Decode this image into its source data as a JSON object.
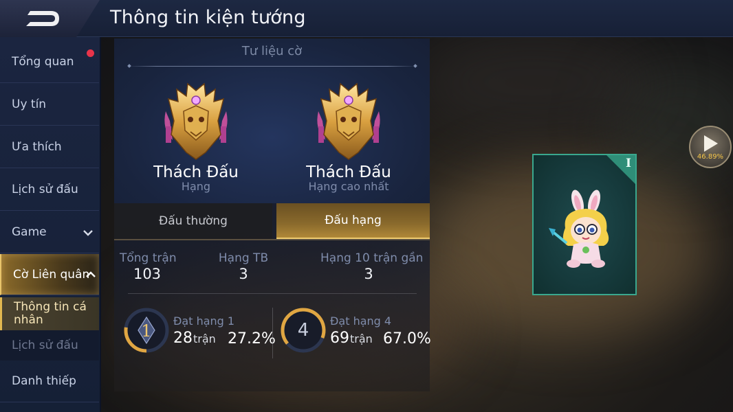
{
  "header": {
    "title": "Thông tin kiện tướng"
  },
  "sidebar": {
    "items": [
      {
        "label": "Tổng quan"
      },
      {
        "label": "Uy tín"
      },
      {
        "label": "Ưa thích"
      },
      {
        "label": "Lịch sử đấu"
      },
      {
        "label": "Game"
      },
      {
        "label": "Cờ Liên quân"
      }
    ],
    "sub_items": [
      {
        "label": "Thông tin cá nhân"
      },
      {
        "label": "Lịch sử đấu"
      }
    ],
    "last_item": {
      "label": "Danh thiếp"
    },
    "notification_color": "#e8344a"
  },
  "panel": {
    "heading": "Tư liệu cờ",
    "ranks": [
      {
        "name": "Thách Đấu",
        "caption": "Hạng"
      },
      {
        "name": "Thách Đấu",
        "caption": "Hạng cao nhất"
      }
    ],
    "tabs": [
      {
        "label": "Đấu thường",
        "active": false
      },
      {
        "label": "Đấu hạng",
        "active": true
      }
    ],
    "stats": [
      {
        "label": "Tổng trận",
        "value": "103"
      },
      {
        "label": "Hạng TB",
        "value": "3"
      },
      {
        "label": "Hạng 10 trận gần",
        "value": "3"
      }
    ],
    "placements": [
      {
        "badge": "1",
        "label": "Đạt hạng 1",
        "count": "28",
        "unit": "trận",
        "percent": "27.2%",
        "fraction": 0.272
      },
      {
        "badge": "4",
        "label": "Đạt hạng 4",
        "count": "69",
        "unit": "trận",
        "percent": "67.0%",
        "fraction": 0.67
      }
    ]
  },
  "card": {
    "tier": "I",
    "icon": "hero-chibi-icon"
  },
  "play": {
    "percent": "46.89%"
  },
  "colors": {
    "accent_gold": "#e8c46a",
    "card_border": "#3aa88e"
  }
}
